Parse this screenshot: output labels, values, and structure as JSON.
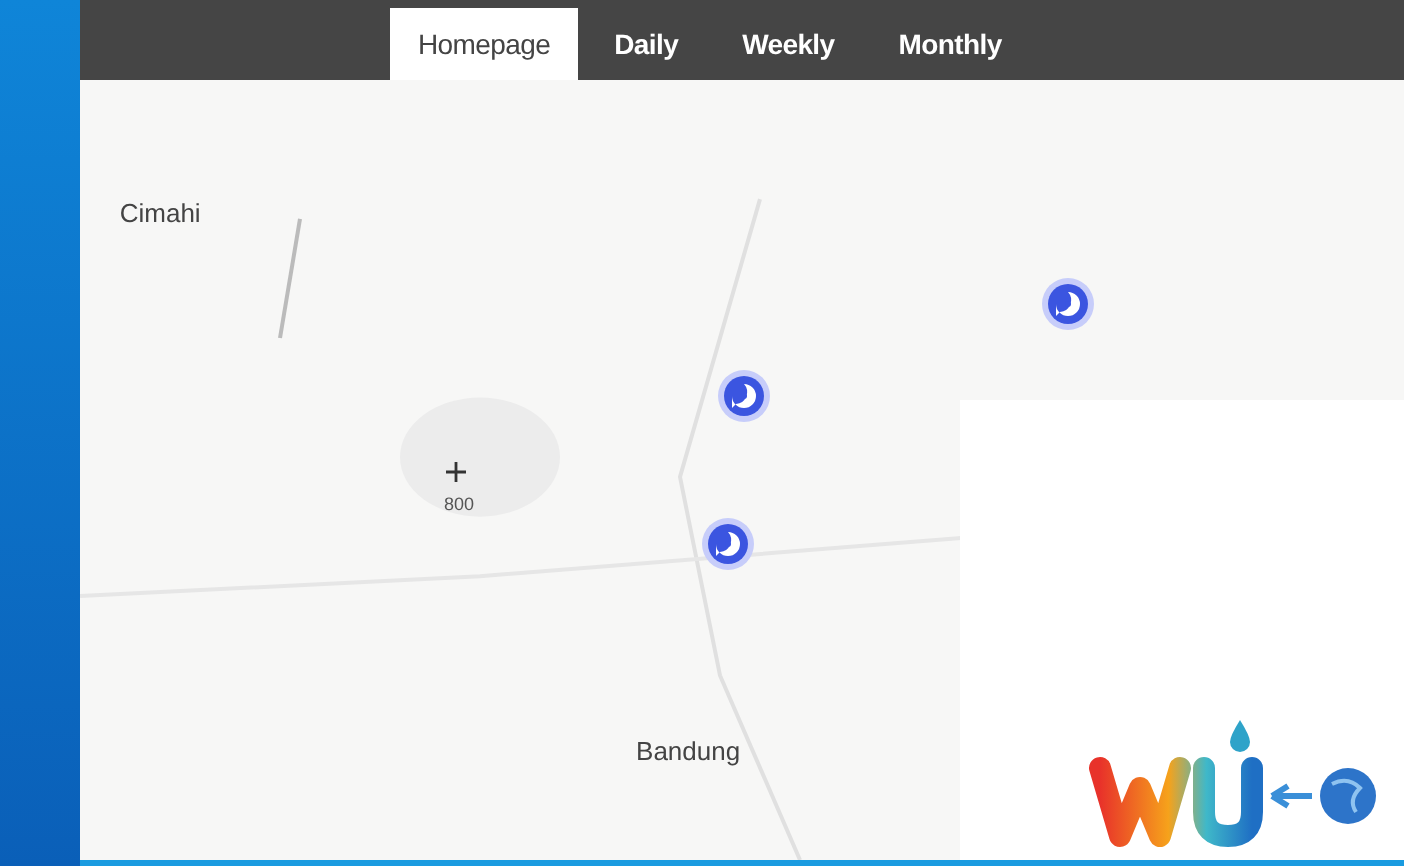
{
  "tabs": [
    {
      "label": "Homepage",
      "selected": true
    },
    {
      "label": "Daily",
      "selected": false
    },
    {
      "label": "Weekly",
      "selected": false
    },
    {
      "label": "Monthly",
      "selected": false
    }
  ],
  "map": {
    "places": [
      {
        "name": "Cimahi",
        "kind": "city"
      },
      {
        "name": "Bandung",
        "kind": "city"
      },
      {
        "name": "800",
        "kind": "elevation"
      }
    ]
  }
}
